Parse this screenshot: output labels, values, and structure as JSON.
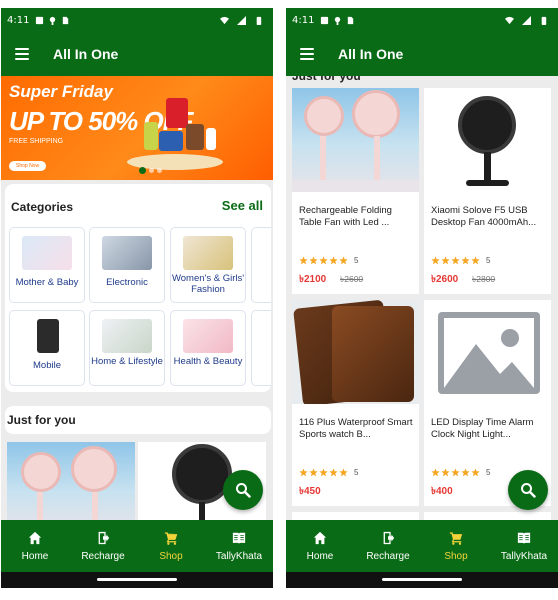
{
  "status": {
    "time": "4:11"
  },
  "appbar": {
    "title": "All In One"
  },
  "banner": {
    "line1": "Super Friday",
    "line2": "UP TO 50% OFF",
    "line3": "FREE SHIPPING",
    "button": "Shop Now"
  },
  "categories": {
    "heading": "Categories",
    "see_all": "See all",
    "items": [
      {
        "label": "Mother & Baby"
      },
      {
        "label": "Electronic"
      },
      {
        "label": "Women's & Girls' Fashion"
      },
      {
        "label": "Mobile"
      },
      {
        "label": "Home & Lifestyle"
      },
      {
        "label": "Health & Beauty"
      }
    ]
  },
  "just_for_you": {
    "heading": "Just for you"
  },
  "products": [
    {
      "name": "Rechargeable Folding Table Fan with Led ...",
      "rating": "5",
      "price": "৳2100",
      "old_price": "৳2600"
    },
    {
      "name": "Xiaomi Solove F5 USB Desktop Fan 4000mAh...",
      "rating": "5",
      "price": "৳2600",
      "old_price": "৳2800"
    },
    {
      "name": "116 Plus Waterproof Smart Sports watch B...",
      "rating": "5",
      "price": "৳450",
      "old_price": ""
    },
    {
      "name": "LED Display Time Alarm Clock Night Light...",
      "rating": "5",
      "price": "৳400",
      "old_price": ""
    }
  ],
  "nav": [
    {
      "label": "Home",
      "icon": "home-icon"
    },
    {
      "label": "Recharge",
      "icon": "recharge-icon"
    },
    {
      "label": "Shop",
      "icon": "cart-icon"
    },
    {
      "label": "TallyKhata",
      "icon": "book-icon"
    }
  ],
  "colors": {
    "primary": "#0a6b17",
    "active_nav": "#f2d43a",
    "price": "#e53935",
    "star": "#f5a623"
  }
}
